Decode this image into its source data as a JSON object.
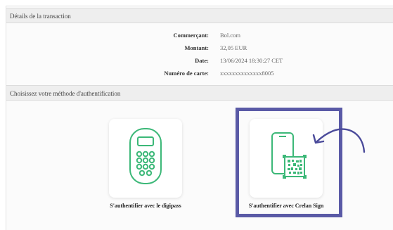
{
  "transaction": {
    "header": "Détails de la transaction",
    "fields": [
      {
        "label": "Commerçant:",
        "value": "Bol.com"
      },
      {
        "label": "Montant:",
        "value": "32,05 EUR"
      },
      {
        "label": "Date:",
        "value": "13/06/2024 18:30:27 CET"
      },
      {
        "label": "Numéro de carte:",
        "value": "xxxxxxxxxxxxxx8005"
      }
    ]
  },
  "auth": {
    "header": "Choisissez votre méthode d'authentification",
    "options": [
      {
        "label": "S'authentifier avec le digipass",
        "icon": "digipass-icon"
      },
      {
        "label": "S'authentifier avec Crelan Sign",
        "icon": "phone-qr-icon"
      }
    ]
  },
  "colors": {
    "icon_green": "#3cb878",
    "highlight": "#5a5aa6",
    "arrow": "#4a4a9a"
  }
}
